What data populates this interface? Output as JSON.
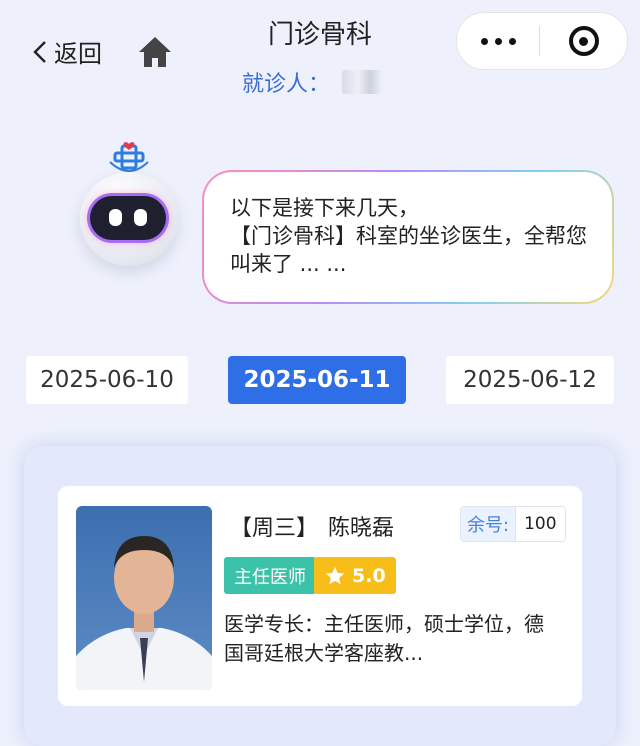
{
  "header": {
    "back_label": "返回",
    "title": "门诊骨科",
    "patient_label": "就诊人："
  },
  "assistant": {
    "message": "以下是接下来几天，\n【门诊骨科】科室的坐诊医生，全帮您叫来了 ... ..."
  },
  "dates": [
    {
      "label": "2025-06-10",
      "selected": false
    },
    {
      "label": "2025-06-11",
      "selected": true
    },
    {
      "label": "2025-06-12",
      "selected": false
    }
  ],
  "doctor": {
    "weekday": "【周三】",
    "name": "陈晓磊",
    "quota_label": "余号:",
    "quota_value": "100",
    "title": "主任医师",
    "rating": "5.0",
    "specialty": "医学专长：主任医师，硕士学位，德国哥廷根大学客座教..."
  },
  "colors": {
    "accent": "#2e6ee6",
    "title_tag": "#3cc2a8",
    "rating_tag": "#f7bd19",
    "patient_label": "#3a6fcf"
  }
}
